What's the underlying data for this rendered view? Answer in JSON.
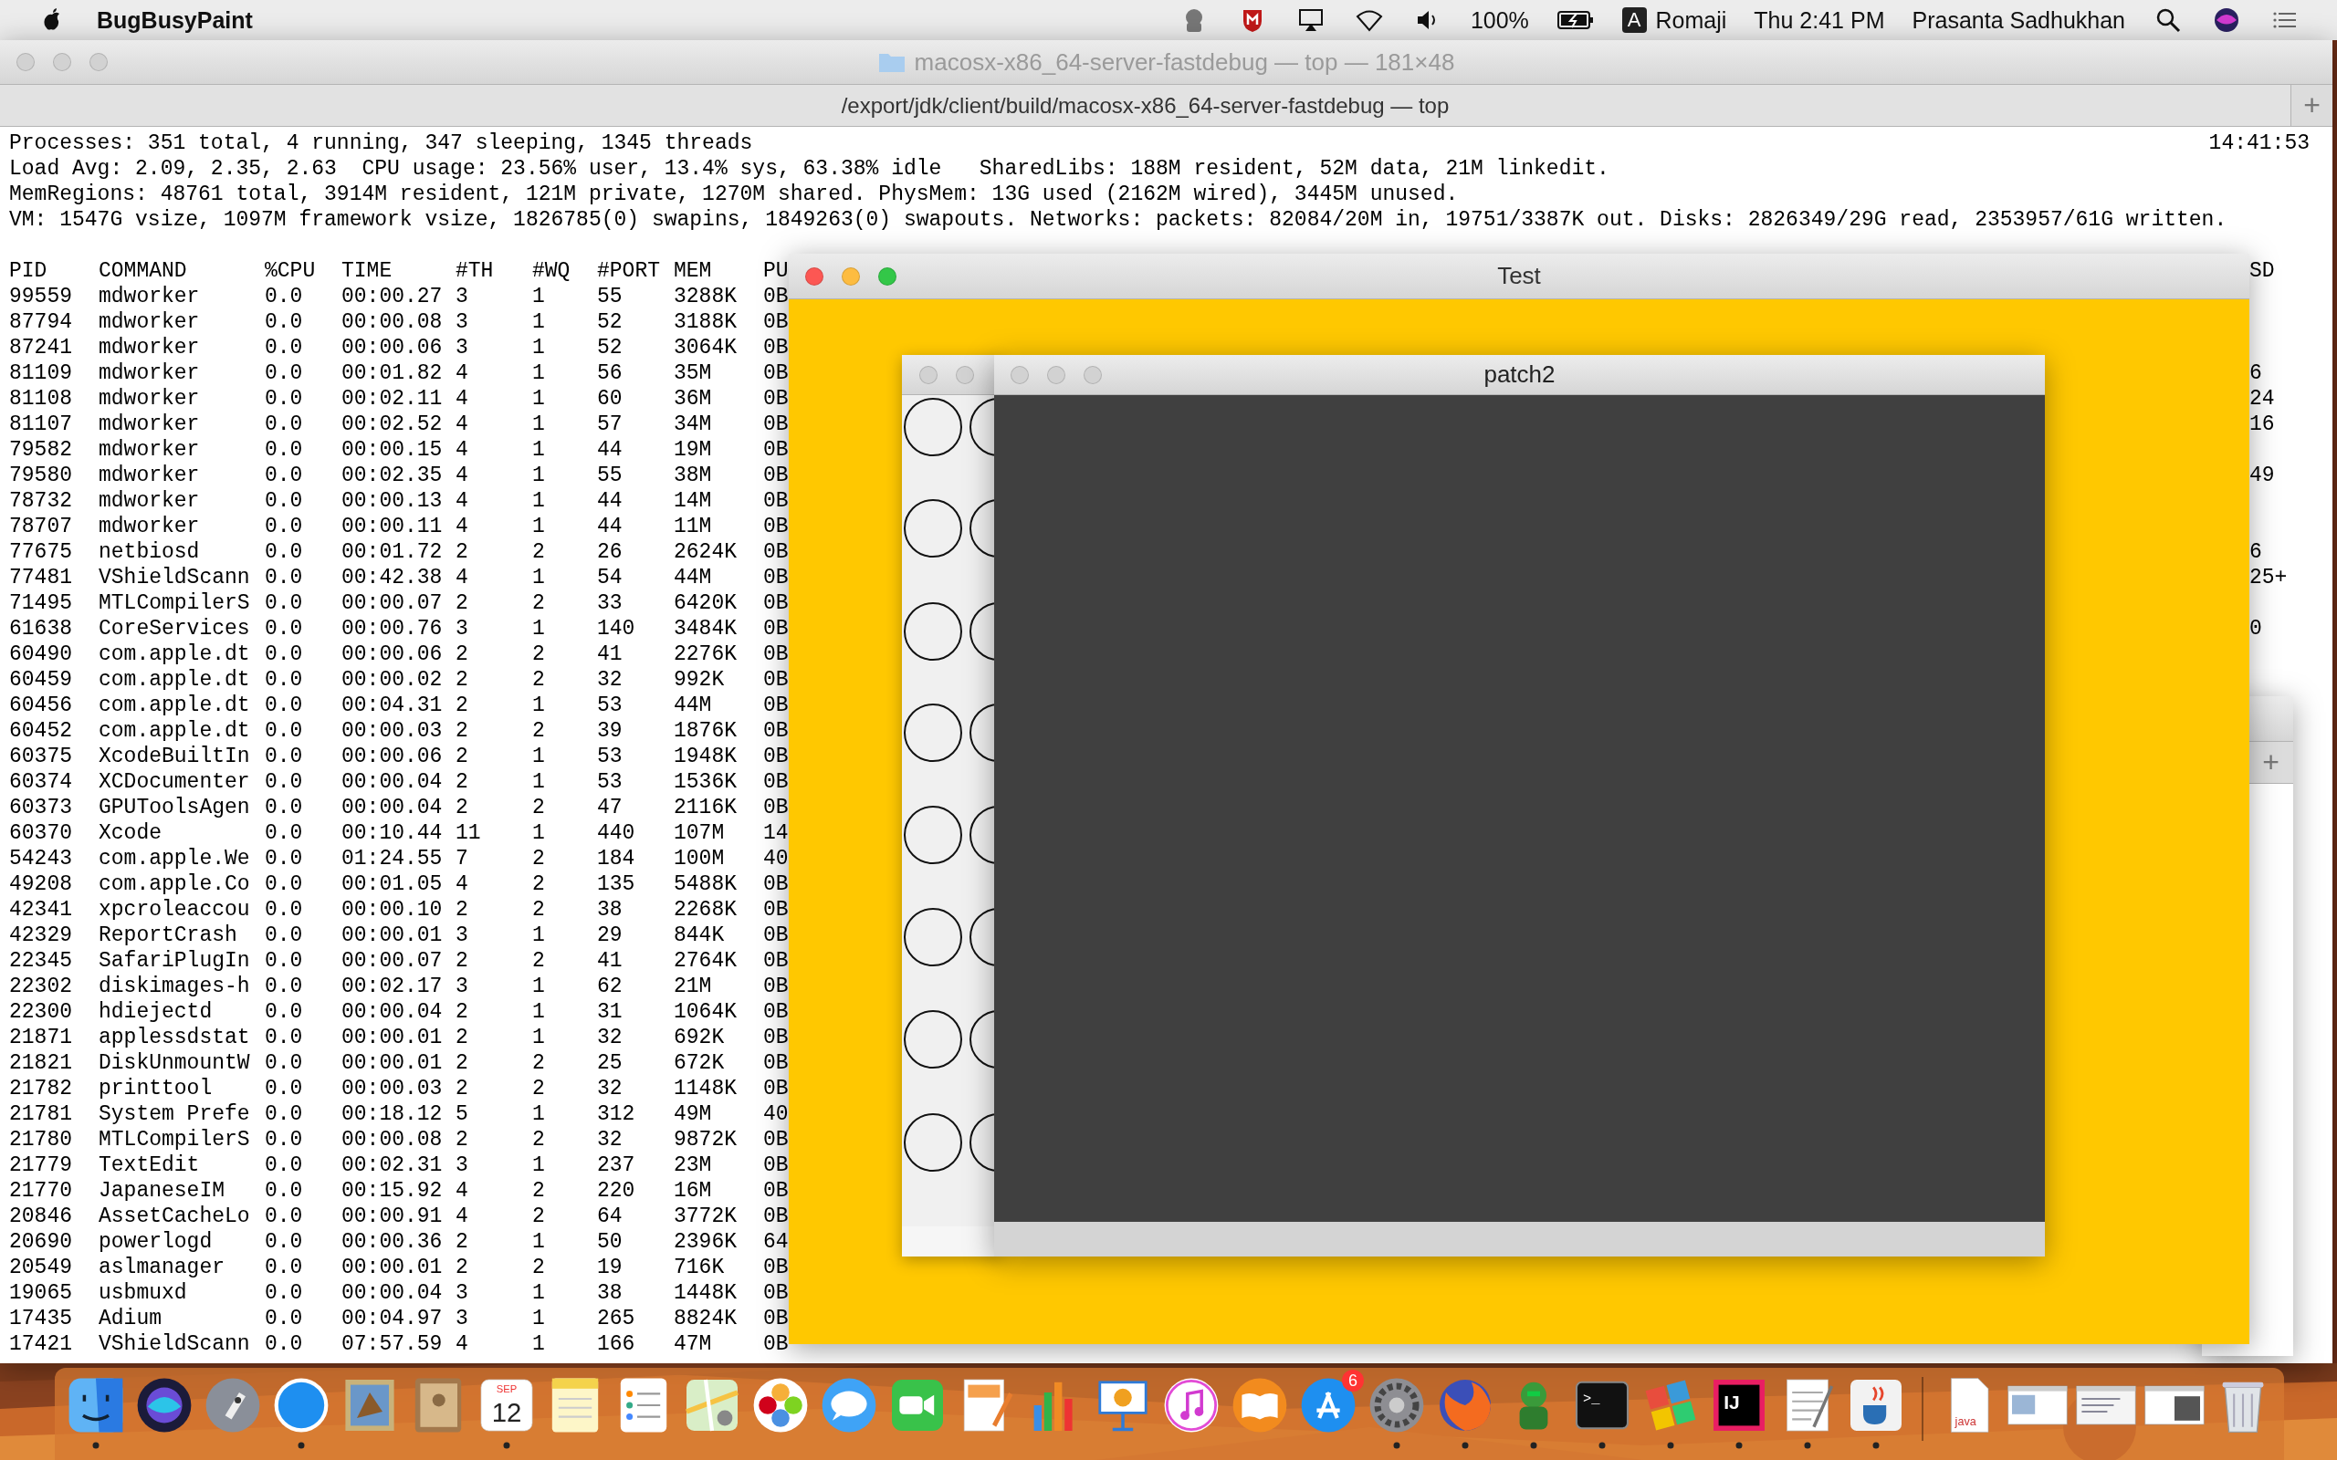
{
  "menu_bar": {
    "app_name": "BugBusyPaint",
    "battery": "100%",
    "input_badge": "A",
    "input_source": "Romaji",
    "clock": "Thu 2:41 PM",
    "user": "Prasanta Sadhukhan"
  },
  "terminal": {
    "active": false,
    "title": "macosx-x86_64-server-fastdebug — top — 181×48",
    "tab_title": "/export/jdk/client/build/macosx-x86_64-server-fastdebug — top",
    "new_tab": "+",
    "clock": "14:41:53",
    "summary_lines": [
      "Processes: 351 total, 4 running, 347 sleeping, 1345 threads",
      "Load Avg: 2.09, 2.35, 2.63  CPU usage: 23.56% user, 13.4% sys, 63.38% idle   SharedLibs: 188M resident, 52M data, 21M linkedit.",
      "MemRegions: 48761 total, 3914M resident, 121M private, 1270M shared. PhysMem: 13G used (2162M wired), 3445M unused.",
      "VM: 1547G vsize, 1097M framework vsize, 1826785(0) swapins, 1849263(0) swapouts. Networks: packets: 82084/20M in, 19751/3387K out. Disks: 2826349/29G read, 2353957/61G written."
    ],
    "columns": [
      "PID",
      "COMMAND",
      "%CPU",
      "TIME",
      "#TH",
      "#WQ",
      "#PORT",
      "MEM",
      "PU"
    ],
    "column_tail": "SD",
    "rows": [
      {
        "cells": [
          "99559",
          "mdworker",
          "0.0",
          "00:00.27",
          "3",
          "1",
          "55",
          "3288K",
          "0B"
        ]
      },
      {
        "cells": [
          "87794",
          "mdworker",
          "0.0",
          "00:00.08",
          "3",
          "1",
          "52",
          "3188K",
          "0B"
        ]
      },
      {
        "cells": [
          "87241",
          "mdworker",
          "0.0",
          "00:00.06",
          "3",
          "1",
          "52",
          "3064K",
          "0B"
        ]
      },
      {
        "cells": [
          "81109",
          "mdworker",
          "0.0",
          "00:01.82",
          "4",
          "1",
          "56",
          "35M",
          "0B"
        ],
        "tail": "6"
      },
      {
        "cells": [
          "81108",
          "mdworker",
          "0.0",
          "00:02.11",
          "4",
          "1",
          "60",
          "36M",
          "0B"
        ],
        "tail": "24"
      },
      {
        "cells": [
          "81107",
          "mdworker",
          "0.0",
          "00:02.52",
          "4",
          "1",
          "57",
          "34M",
          "0B"
        ],
        "tail": "16"
      },
      {
        "cells": [
          "79582",
          "mdworker",
          "0.0",
          "00:00.15",
          "4",
          "1",
          "44",
          "19M",
          "0B"
        ]
      },
      {
        "cells": [
          "79580",
          "mdworker",
          "0.0",
          "00:02.35",
          "4",
          "1",
          "55",
          "38M",
          "0B"
        ],
        "tail": "49"
      },
      {
        "cells": [
          "78732",
          "mdworker",
          "0.0",
          "00:00.13",
          "4",
          "1",
          "44",
          "14M",
          "0B"
        ]
      },
      {
        "cells": [
          "78707",
          "mdworker",
          "0.0",
          "00:00.11",
          "4",
          "1",
          "44",
          "11M",
          "0B"
        ]
      },
      {
        "cells": [
          "77675",
          "netbiosd",
          "0.0",
          "00:01.72",
          "2",
          "2",
          "26",
          "2624K",
          "0B"
        ],
        "tail": "6"
      },
      {
        "cells": [
          "77481",
          "VShieldScann",
          "0.0",
          "00:42.38",
          "4",
          "1",
          "54",
          "44M",
          "0B"
        ],
        "tail": "25+"
      },
      {
        "cells": [
          "71495",
          "MTLCompilerS",
          "0.0",
          "00:00.07",
          "2",
          "2",
          "33",
          "6420K",
          "0B"
        ]
      },
      {
        "cells": [
          "61638",
          "CoreServices",
          "0.0",
          "00:00.76",
          "3",
          "1",
          "140",
          "3484K",
          "0B"
        ],
        "tail": "0"
      },
      {
        "cells": [
          "60490",
          "com.apple.dt",
          "0.0",
          "00:00.06",
          "2",
          "2",
          "41",
          "2276K",
          "0B"
        ]
      },
      {
        "cells": [
          "60459",
          "com.apple.dt",
          "0.0",
          "00:00.02",
          "2",
          "2",
          "32",
          "992K",
          "0B"
        ]
      },
      {
        "cells": [
          "60456",
          "com.apple.dt",
          "0.0",
          "00:04.31",
          "2",
          "1",
          "53",
          "44M",
          "0B"
        ]
      },
      {
        "cells": [
          "60452",
          "com.apple.dt",
          "0.0",
          "00:00.03",
          "2",
          "2",
          "39",
          "1876K",
          "0B"
        ]
      },
      {
        "cells": [
          "60375",
          "XcodeBuiltIn",
          "0.0",
          "00:00.06",
          "2",
          "1",
          "53",
          "1948K",
          "0B"
        ]
      },
      {
        "cells": [
          "60374",
          "XCDocumenter",
          "0.0",
          "00:00.04",
          "2",
          "1",
          "53",
          "1536K",
          "0B"
        ]
      },
      {
        "cells": [
          "60373",
          "GPUToolsAgen",
          "0.0",
          "00:00.04",
          "2",
          "2",
          "47",
          "2116K",
          "0B"
        ]
      },
      {
        "cells": [
          "60370",
          "Xcode",
          "0.0",
          "00:10.44",
          "11",
          "1",
          "440",
          "107M",
          "14"
        ]
      },
      {
        "cells": [
          "54243",
          "com.apple.We",
          "0.0",
          "01:24.55",
          "7",
          "2",
          "184",
          "100M",
          "40"
        ]
      },
      {
        "cells": [
          "49208",
          "com.apple.Co",
          "0.0",
          "00:01.05",
          "4",
          "2",
          "135",
          "5488K",
          "0B"
        ]
      },
      {
        "cells": [
          "42341",
          "xpcroleaccou",
          "0.0",
          "00:00.10",
          "2",
          "2",
          "38",
          "2268K",
          "0B"
        ]
      },
      {
        "cells": [
          "42329",
          "ReportCrash",
          "0.0",
          "00:00.01",
          "3",
          "1",
          "29",
          "844K",
          "0B"
        ]
      },
      {
        "cells": [
          "22345",
          "SafariPlugIn",
          "0.0",
          "00:00.07",
          "2",
          "2",
          "41",
          "2764K",
          "0B"
        ]
      },
      {
        "cells": [
          "22302",
          "diskimages-h",
          "0.0",
          "00:02.17",
          "3",
          "1",
          "62",
          "21M",
          "0B"
        ]
      },
      {
        "cells": [
          "22300",
          "hdiejectd",
          "0.0",
          "00:00.04",
          "2",
          "1",
          "31",
          "1064K",
          "0B"
        ]
      },
      {
        "cells": [
          "21871",
          "applessdstat",
          "0.0",
          "00:00.01",
          "2",
          "1",
          "32",
          "692K",
          "0B"
        ]
      },
      {
        "cells": [
          "21821",
          "DiskUnmountW",
          "0.0",
          "00:00.01",
          "2",
          "2",
          "25",
          "672K",
          "0B"
        ]
      },
      {
        "cells": [
          "21782",
          "printtool",
          "0.0",
          "00:00.03",
          "2",
          "2",
          "32",
          "1148K",
          "0B"
        ]
      },
      {
        "cells": [
          "21781",
          "System Prefe",
          "0.0",
          "00:18.12",
          "5",
          "1",
          "312",
          "49M",
          "40"
        ]
      },
      {
        "cells": [
          "21780",
          "MTLCompilerS",
          "0.0",
          "00:00.08",
          "2",
          "2",
          "32",
          "9872K",
          "0B"
        ]
      },
      {
        "cells": [
          "21779",
          "TextEdit",
          "0.0",
          "00:02.31",
          "3",
          "1",
          "237",
          "23M",
          "0B"
        ]
      },
      {
        "cells": [
          "21770",
          "JapaneseIM",
          "0.0",
          "00:15.92",
          "4",
          "2",
          "220",
          "16M",
          "0B"
        ]
      },
      {
        "cells": [
          "20846",
          "AssetCacheLo",
          "0.0",
          "00:00.91",
          "4",
          "2",
          "64",
          "3772K",
          "0B"
        ]
      },
      {
        "cells": [
          "20690",
          "powerlogd",
          "0.0",
          "00:00.36",
          "2",
          "1",
          "50",
          "2396K",
          "64"
        ]
      },
      {
        "cells": [
          "20549",
          "aslmanager",
          "0.0",
          "00:00.01",
          "2",
          "2",
          "19",
          "716K",
          "0B"
        ]
      },
      {
        "cells": [
          "19065",
          "usbmuxd",
          "0.0",
          "00:00.04",
          "3",
          "1",
          "38",
          "1448K",
          "0B"
        ]
      },
      {
        "cells": [
          "17435",
          "Adium",
          "0.0",
          "00:04.97",
          "3",
          "1",
          "265",
          "8824K",
          "0B"
        ]
      },
      {
        "cells": [
          "17421",
          "VShieldScann",
          "0.0",
          "07:57.59",
          "4",
          "1",
          "166",
          "47M",
          "0B"
        ]
      }
    ]
  },
  "background_terminal": {
    "new_tab": "+"
  },
  "test_window": {
    "title": "Test",
    "active": true
  },
  "patch2_window": {
    "title": "patch2",
    "active": false
  },
  "dock": {
    "items": [
      {
        "running": true
      },
      {
        "running": false
      },
      {
        "running": false
      },
      {
        "running": true
      },
      {
        "running": false
      },
      {
        "running": false
      },
      {
        "running": true,
        "month": "SEP",
        "day": "12"
      },
      {
        "running": false
      },
      {
        "running": false
      },
      {
        "running": false
      },
      {
        "running": false
      },
      {
        "running": false
      },
      {
        "running": false
      },
      {
        "running": false
      },
      {
        "running": false
      },
      {
        "running": false
      },
      {
        "running": false
      },
      {
        "running": false
      },
      {
        "running": false,
        "badge": "6"
      },
      {
        "running": true
      },
      {
        "running": true
      },
      {
        "running": true
      },
      {
        "running": true,
        "label": ">_"
      },
      {
        "running": true
      },
      {
        "running": true,
        "label": "IJ"
      },
      {
        "running": true
      },
      {
        "running": true
      },
      {
        "running": false,
        "label": "java"
      },
      {
        "running": false
      },
      {
        "running": false
      },
      {
        "running": false
      },
      {
        "running": false
      }
    ]
  }
}
